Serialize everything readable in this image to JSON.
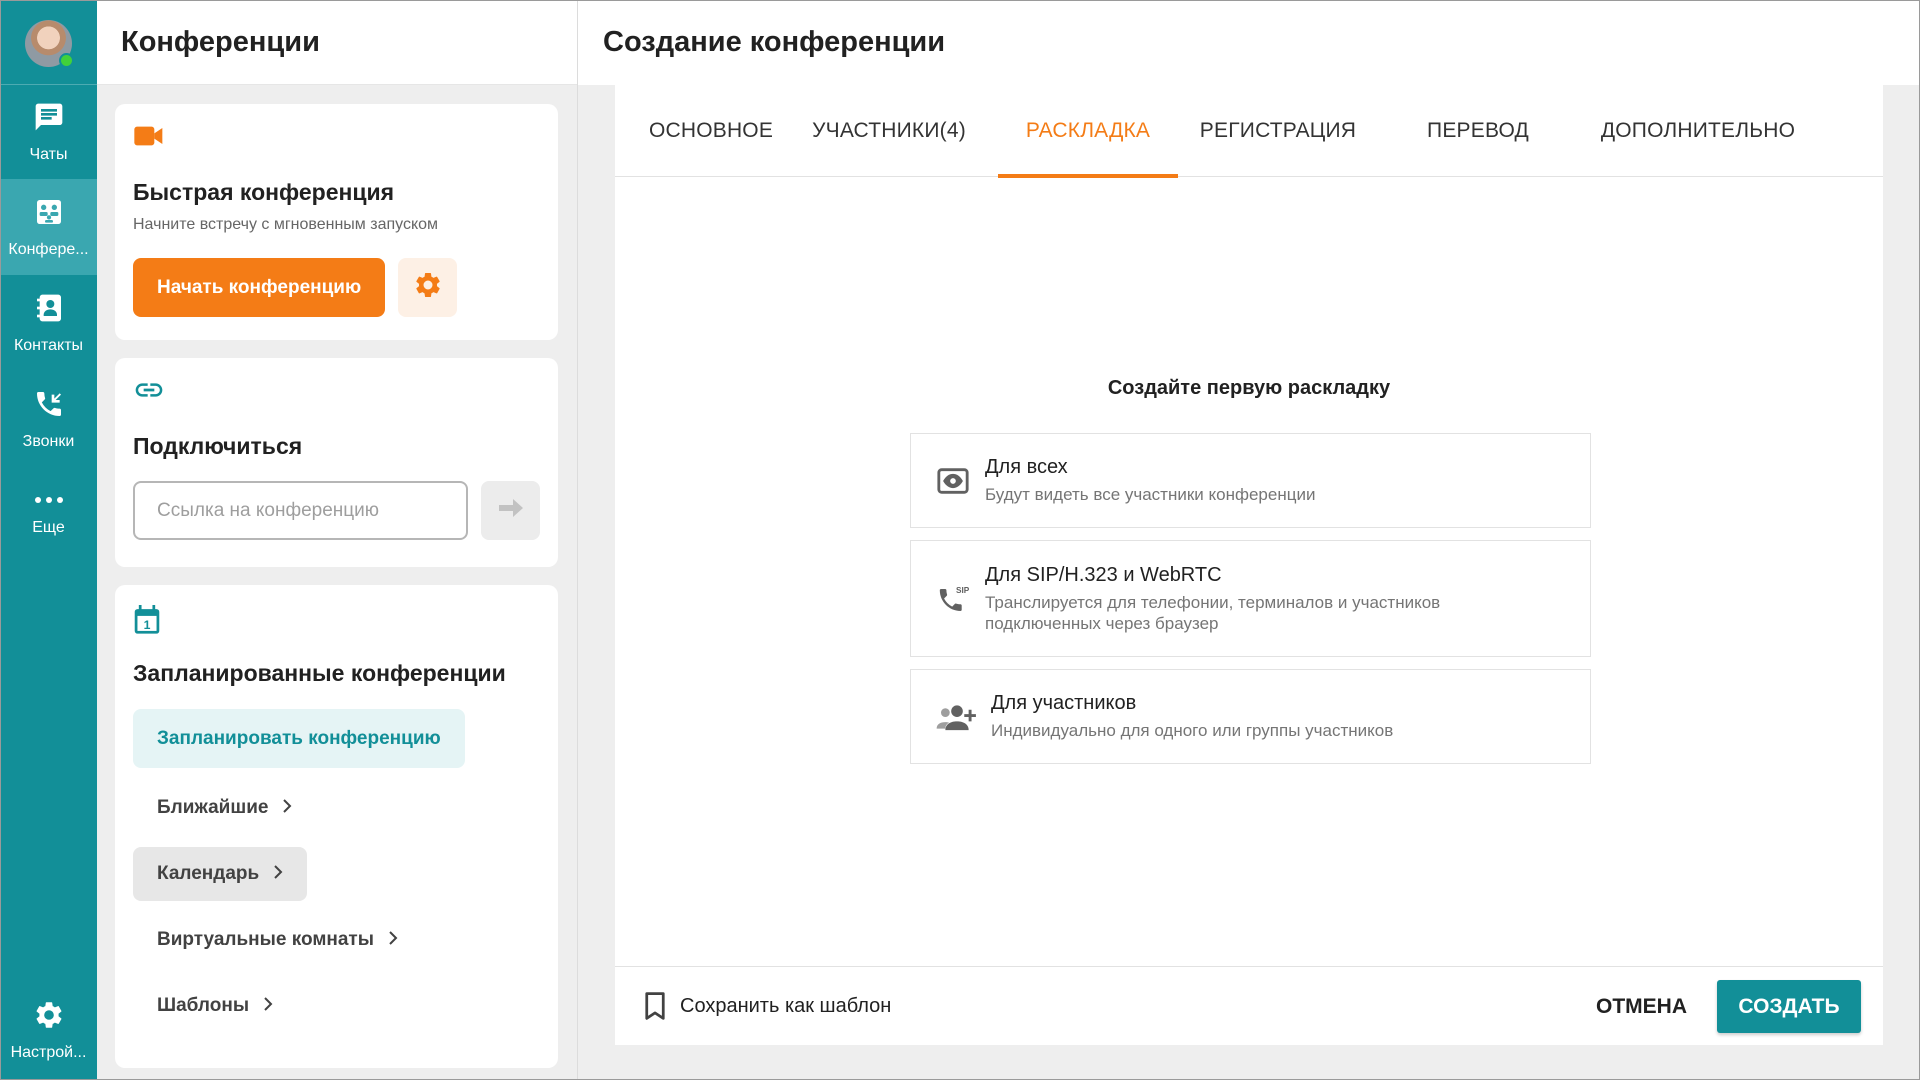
{
  "rail": {
    "items": [
      {
        "label": "Чаты",
        "icon": "chat-icon"
      },
      {
        "label": "Конфере...",
        "icon": "conference-icon",
        "active": true
      },
      {
        "label": "Контакты",
        "icon": "contacts-icon"
      },
      {
        "label": "Звонки",
        "icon": "calls-icon"
      },
      {
        "label": "Еще",
        "icon": "more-icon"
      }
    ],
    "settings_label": "Настрой...",
    "presence_color": "#41d13a"
  },
  "left": {
    "title": "Конференции",
    "quick": {
      "title": "Быстрая конференция",
      "subtitle": "Начните встречу с мгновенным запуском",
      "start_label": "Начать конференцию"
    },
    "join": {
      "title": "Подключиться",
      "placeholder": "Ссылка на конференцию"
    },
    "scheduled": {
      "title": "Запланированные конференции",
      "schedule_label": "Запланировать конференцию",
      "links": [
        "Ближайшие",
        "Календарь",
        "Виртуальные комнаты",
        "Шаблоны"
      ]
    }
  },
  "right": {
    "title": "Создание конференции",
    "tabs": [
      "ОСНОВНОЕ",
      "УЧАСТНИКИ(4)",
      "РАСКЛАДКА",
      "РЕГИСТРАЦИЯ",
      "ПЕРЕВОД",
      "ДОПОЛНИТЕЛЬНО"
    ],
    "active_tab": "РАСКЛАДКА",
    "empty_title": "Создайте первую раскладку",
    "options": [
      {
        "title": "Для всех",
        "subtitle": "Будут видеть все участники конференции",
        "icon": "eye-screen-icon"
      },
      {
        "title": "Для SIP/H.323 и WebRTC",
        "subtitle": "Транслируется для телефонии, терминалов и участников подключенных через браузер",
        "icon": "sip-phone-icon"
      },
      {
        "title": "Для участников",
        "subtitle": "Индивидуально для одного или группы участников",
        "icon": "add-group-icon"
      }
    ],
    "save_template_label": "Сохранить как шаблон",
    "cancel_label": "ОТМЕНА",
    "create_label": "СОЗДАТЬ"
  },
  "colors": {
    "rail": "#128f98",
    "accent_orange": "#f47c16",
    "teal": "#128f98"
  }
}
